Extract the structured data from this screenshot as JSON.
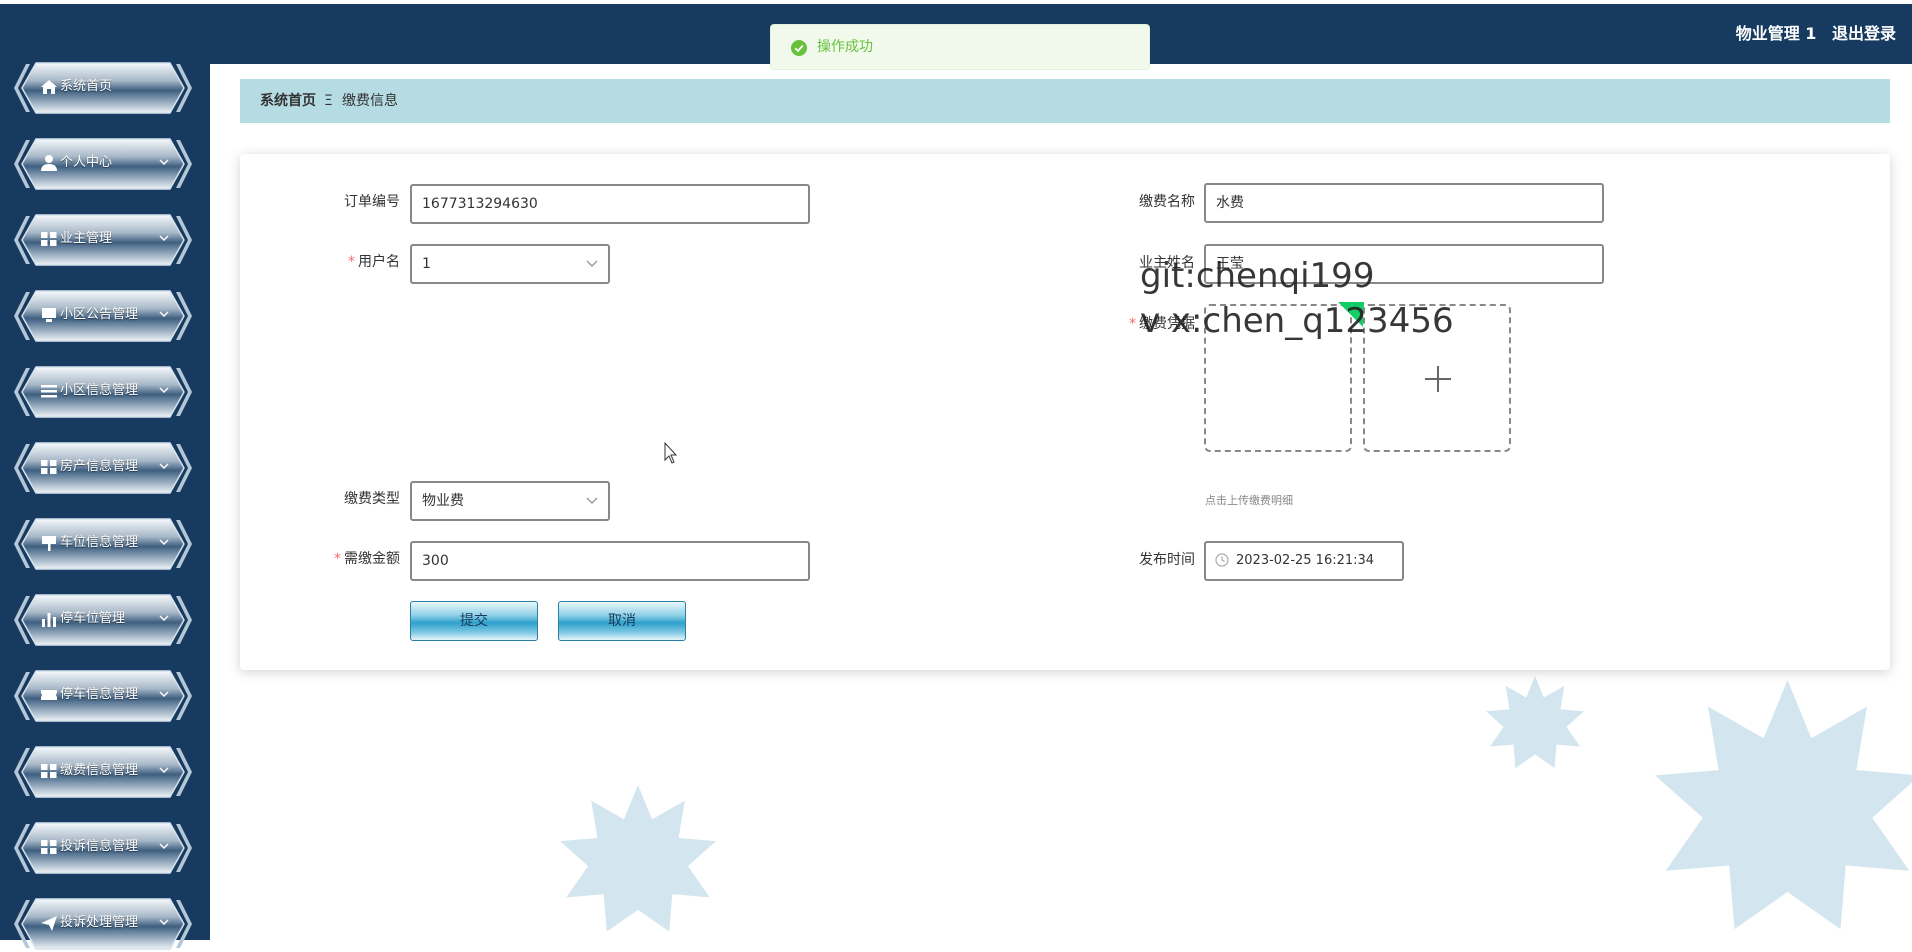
{
  "header": {
    "user": "物业管理 1",
    "logout": "退出登录"
  },
  "toast": {
    "message": "操作成功"
  },
  "breadcrumb": {
    "home": "系统首页",
    "separator": "Ξ",
    "current": "缴费信息"
  },
  "sidebar": {
    "items": [
      {
        "label": "系统首页",
        "icon": "home-icon"
      },
      {
        "label": "个人中心",
        "icon": "user-icon"
      },
      {
        "label": "业主管理",
        "icon": "grid-icon"
      },
      {
        "label": "小区公告管理",
        "icon": "monitor-icon"
      },
      {
        "label": "小区信息管理",
        "icon": "list-icon"
      },
      {
        "label": "房产信息管理",
        "icon": "grid-icon"
      },
      {
        "label": "车位信息管理",
        "icon": "sign-icon"
      },
      {
        "label": "停车位管理",
        "icon": "bar-chart-icon"
      },
      {
        "label": "停车信息管理",
        "icon": "ticket-icon"
      },
      {
        "label": "缴费信息管理",
        "icon": "grid-icon"
      },
      {
        "label": "投诉信息管理",
        "icon": "grid-icon"
      },
      {
        "label": "投诉处理管理",
        "icon": "send-icon"
      }
    ]
  },
  "form": {
    "order_no": {
      "label": "订单编号",
      "value": "1677313294630"
    },
    "fee_name": {
      "label": "缴费名称",
      "value": "水费"
    },
    "username": {
      "label": "用户名",
      "value": "1"
    },
    "owner_name": {
      "label": "业主姓名",
      "value": "王莹"
    },
    "receipt": {
      "label": "缴费凭据",
      "hint": "点击上传缴费明细"
    },
    "fee_type": {
      "label": "缴费类型",
      "value": "物业费"
    },
    "amount": {
      "label": "需缴金额",
      "value": "300"
    },
    "publish_time": {
      "label": "发布时间",
      "value": "2023-02-25 16:21:34"
    },
    "submit": "提交",
    "cancel": "取消"
  },
  "watermark": {
    "line1": "git:chenqi199",
    "line2": "v x:chen_q123456"
  },
  "colors": {
    "navy": "#163a60",
    "breadcrumb_bg": "#b6dce3",
    "success": "#67c23a",
    "required": "#f56c6c"
  }
}
